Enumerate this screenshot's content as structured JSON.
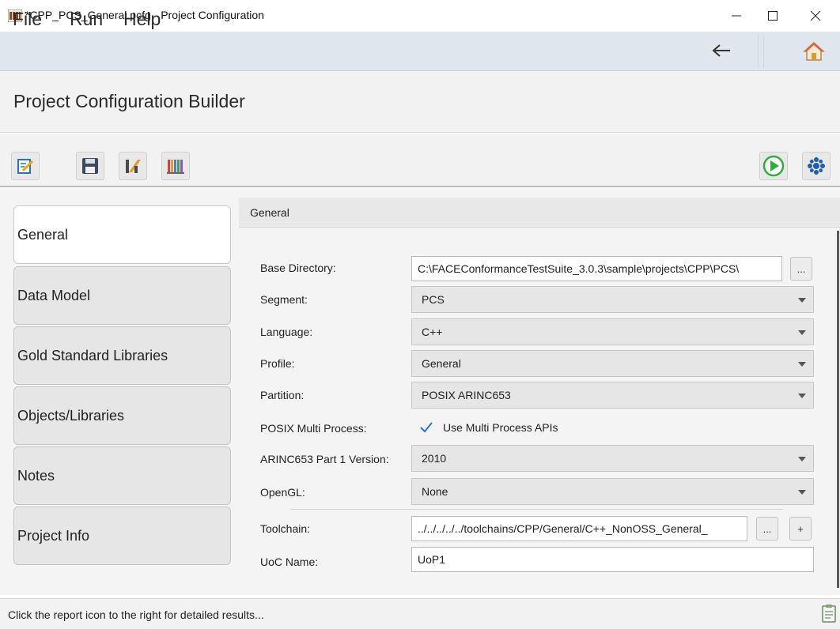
{
  "window": {
    "title": "*CPP_PCS_General.pcfg - Project Configuration",
    "app_icon": "face-logo-icon"
  },
  "menu": {
    "items": [
      "File",
      "Run",
      "Help"
    ]
  },
  "header": {
    "title": "Project Configuration Builder"
  },
  "toolbar": {
    "left_icons": [
      "edit-icon",
      "save-icon",
      "build-icon",
      "library-icon"
    ],
    "right_icons": [
      "run-icon",
      "settings-icon"
    ]
  },
  "nav": {
    "tabs": [
      "General",
      "Data Model",
      "Gold Standard Libraries",
      "Objects/Libraries",
      "Notes",
      "Project Info"
    ],
    "active": "General"
  },
  "section": {
    "title": "General"
  },
  "form": {
    "base_directory": {
      "label": "Base Directory:",
      "value": "C:\\FACEConformanceTestSuite_3.0.3\\sample\\projects\\CPP\\PCS\\",
      "browse": "..."
    },
    "segment": {
      "label": "Segment:",
      "value": "PCS"
    },
    "language": {
      "label": "Language:",
      "value": "C++"
    },
    "profile": {
      "label": "Profile:",
      "value": "General"
    },
    "partition": {
      "label": "Partition:",
      "value": "POSIX ARINC653"
    },
    "posix_multi_process": {
      "label": "POSIX Multi Process:",
      "checkbox_label": "Use Multi Process APIs",
      "checked": true
    },
    "arinc_version": {
      "label": "ARINC653 Part 1 Version:",
      "value": "2010"
    },
    "opengl": {
      "label": "OpenGL:",
      "value": "None"
    },
    "toolchain": {
      "label": "Toolchain:",
      "value": "../../../../../toolchains/CPP/General/C++_NonOSS_General_",
      "browse": "...",
      "add": "+"
    },
    "uoc_name": {
      "label": "UoC Name:",
      "value": "UoP1"
    }
  },
  "status": {
    "text": "Click the report icon to the right for detailed results...",
    "icon": "report-icon"
  },
  "colors": {
    "menubar": "#dfe6ee",
    "run_green": "#2fae3a",
    "settings_blue": "#1f5fb0",
    "check_blue": "#2a6fd6"
  }
}
